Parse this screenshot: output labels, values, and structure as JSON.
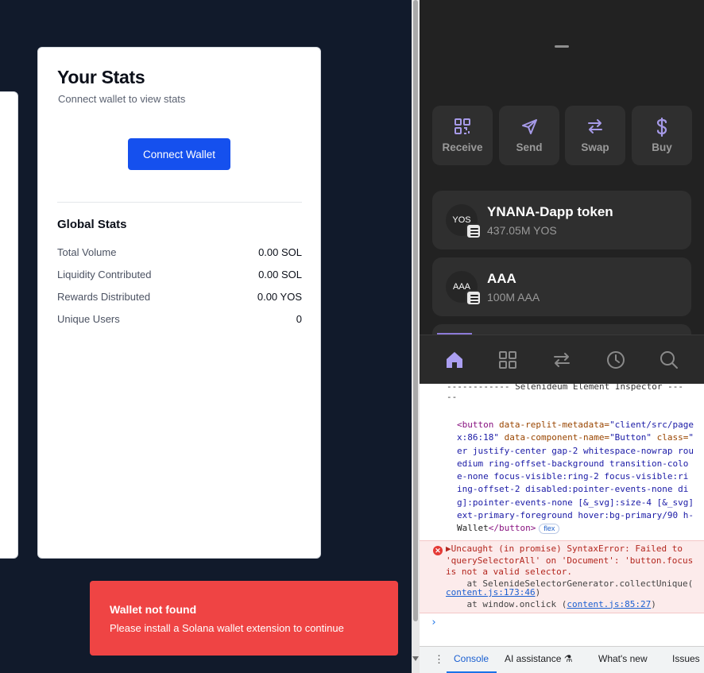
{
  "stats_card": {
    "title": "Your Stats",
    "subtitle": "Connect wallet to view stats",
    "connect_label": "Connect Wallet",
    "global_title": "Global Stats",
    "rows": [
      {
        "label": "Total Volume",
        "value": "0.00 SOL"
      },
      {
        "label": "Liquidity Contributed",
        "value": "0.00 SOL"
      },
      {
        "label": "Rewards Distributed",
        "value": "0.00 YOS"
      },
      {
        "label": "Unique Users",
        "value": "0"
      }
    ]
  },
  "toast": {
    "title": "Wallet not found",
    "message": "Please install a Solana wallet extension to continue"
  },
  "wallet": {
    "actions": [
      {
        "label": "Receive",
        "icon": "qr-code-icon"
      },
      {
        "label": "Send",
        "icon": "send-icon"
      },
      {
        "label": "Swap",
        "icon": "swap-icon"
      },
      {
        "label": "Buy",
        "icon": "dollar-icon"
      }
    ],
    "tokens": [
      {
        "avatar": "YOS",
        "name": "YNANA-Dapp token",
        "amount": "437.05M YOS"
      },
      {
        "avatar": "AAA",
        "name": "AAA",
        "amount": "100M AAA"
      }
    ],
    "nav": [
      "home-icon",
      "apps-grid-icon",
      "swap-arrows-icon",
      "history-clock-icon",
      "search-icon"
    ],
    "accent_color": "#ab9ff2"
  },
  "devtools": {
    "inspector_header": "------------ Selenideum Element Inspector ---\n--",
    "code": {
      "l1_tag_open": "<button",
      "l1_attr1": " data-replit-metadata=",
      "l1_val1": "\"client/src/page",
      "l2_val1_end": "x:86:18\"",
      "l2_attr2": " data-component-name=",
      "l2_val2": "\"Button\"",
      "l2_attr3": " class=",
      "l2_val3": "\"",
      "l3": "er justify-center gap-2 whitespace-nowrap rou",
      "l4": "edium ring-offset-background transition-colo",
      "l5": "e-none focus-visible:ring-2 focus-visible:ri",
      "l6": "ing-offset-2 disabled:pointer-events-none di",
      "l7": "g]:pointer-events-none [&_svg]:size-4 [&_svg]",
      "l8": "ext-primary-foreground hover:bg-primary/90 h-",
      "l9_text": "Wallet",
      "l9_close": "</button>",
      "badge": "flex"
    },
    "error": {
      "line1": "▶Uncaught (in promise) SyntaxError: Failed to",
      "line2": "'querySelectorAll' on 'Document': 'button.focus",
      "line3": "is not a valid selector.",
      "line4": "    at SelenideSelectorGenerator.collectUnique(",
      "link1": "content.js:173:46",
      "link1_suffix": ")",
      "line6_prefix": "    at window.onclick (",
      "link2": "content.js:85:27",
      "link2_suffix": ")"
    },
    "prompt": "›",
    "tabs": [
      "Console",
      "AI assistance ⚗",
      "What's new",
      "Issues"
    ]
  }
}
